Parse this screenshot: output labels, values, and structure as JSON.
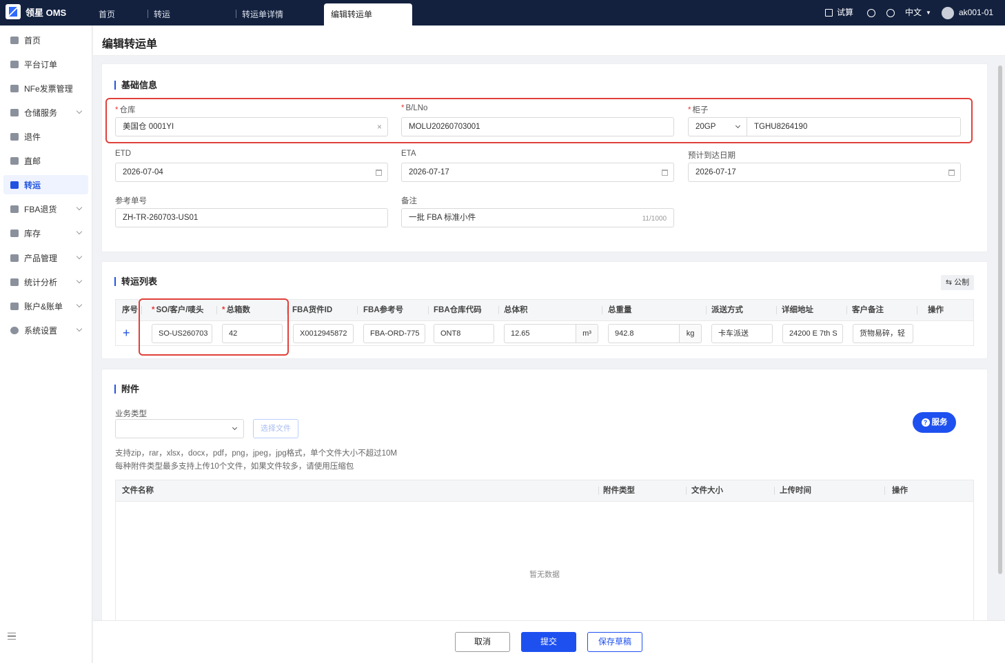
{
  "app": {
    "name": "领星 OMS"
  },
  "tabs": [
    "首页",
    "转运",
    "转运单详情",
    "编辑转运单"
  ],
  "topbar": {
    "trial": "试算",
    "language": "中文",
    "user": "ak001-01"
  },
  "sidebar": {
    "items": [
      {
        "label": "首页",
        "icon": "home-icon"
      },
      {
        "label": "平台订单",
        "icon": "order-icon"
      },
      {
        "label": "NFe发票管理",
        "icon": "invoice-icon"
      },
      {
        "label": "仓储服务",
        "icon": "warehouse-icon"
      },
      {
        "label": "退件",
        "icon": "return-icon"
      },
      {
        "label": "直邮",
        "icon": "mail-icon"
      },
      {
        "label": "转运",
        "icon": "transfer-icon"
      },
      {
        "label": "FBA退货",
        "icon": "fba-icon"
      },
      {
        "label": "库存",
        "icon": "inventory-icon"
      },
      {
        "label": "产品管理",
        "icon": "product-icon"
      },
      {
        "label": "统计分析",
        "icon": "chart-icon"
      },
      {
        "label": "账户&账单",
        "icon": "account-icon"
      },
      {
        "label": "系统设置",
        "icon": "settings-icon"
      }
    ]
  },
  "page": {
    "title": "编辑转运单"
  },
  "basic": {
    "title": "基础信息",
    "warehouse": {
      "label": "仓库",
      "value": "美国仓 0001YI"
    },
    "bl": {
      "label": "B/LNo",
      "value": "MOLU20260703001"
    },
    "container": {
      "label": "柜子",
      "type": "20GP",
      "number": "TGHU8264190"
    },
    "etd": {
      "label": "ETD",
      "value": "2026-07-04"
    },
    "eta": {
      "label": "ETA",
      "value": "2026-07-17"
    },
    "arrival": {
      "label": "预计到达日期",
      "value": "2026-07-17"
    },
    "ref": {
      "label": "参考单号",
      "value": "ZH-TR-260703-US01"
    },
    "remark": {
      "label": "备注",
      "value": "一批 FBA 标准小件",
      "count": "11/1000"
    }
  },
  "transfer": {
    "title": "转运列表",
    "unit_toggle": "公制",
    "columns": [
      "序号",
      "SO/客户/唛头",
      "总箱数",
      "FBA货件ID",
      "FBA参考号",
      "FBA仓库代码",
      "总体积",
      "总重量",
      "派送方式",
      "详细地址",
      "客户备注",
      "操作"
    ],
    "row": {
      "so": "SO-US260703",
      "boxes": "42",
      "fba_id": "X0012945872",
      "fba_ref": "FBA-ORD-775",
      "fba_code": "ONT8",
      "volume": "12.65",
      "volume_unit": "m³",
      "weight": "942.8",
      "weight_unit": "kg",
      "delivery": "卡车派送",
      "address": "24200 E 7th S",
      "note": "货物易碎，轻"
    }
  },
  "attach": {
    "title": "附件",
    "biz_label": "业务类型",
    "choose": "选择文件",
    "hint1": "支持zip，rar，xlsx，docx，pdf，png，jpeg，jpg格式，单个文件大小不超过10M",
    "hint2": "每种附件类型最多支持上传10个文件，如果文件较多，请使用压缩包",
    "columns": [
      "文件名称",
      "附件类型",
      "文件大小",
      "上传时间",
      "操作"
    ],
    "empty": "暂无数据"
  },
  "service": "服务",
  "footer": {
    "cancel": "取消",
    "submit": "提交",
    "draft": "保存草稿"
  }
}
